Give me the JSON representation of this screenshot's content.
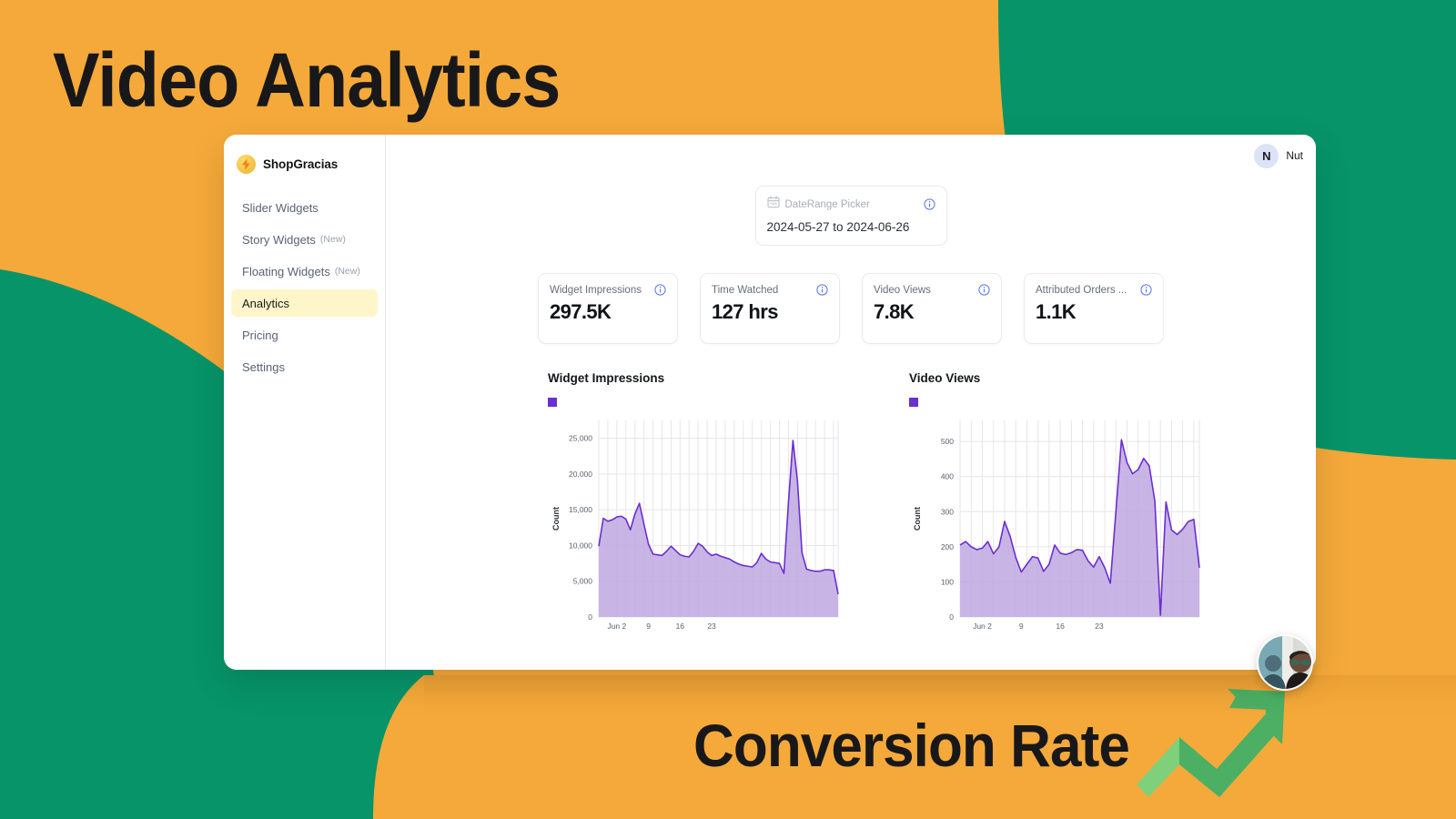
{
  "promo": {
    "headline": "Video Analytics",
    "footline": "Conversion Rate",
    "bg_orange": "#F5A93A",
    "bg_green": "#079468",
    "arrow_light": "#7FD07A",
    "arrow_dark": "#4CAF63"
  },
  "sidebar": {
    "brand": "ShopGracias",
    "brand_icon": "lightning-bolt-icon",
    "items": [
      {
        "label": "Slider Widgets",
        "badge": "",
        "active": false
      },
      {
        "label": "Story Widgets",
        "badge": "(New)",
        "active": false
      },
      {
        "label": "Floating Widgets",
        "badge": "(New)",
        "active": false
      },
      {
        "label": "Analytics",
        "badge": "",
        "active": true
      },
      {
        "label": "Pricing",
        "badge": "",
        "active": false
      },
      {
        "label": "Settings",
        "badge": "",
        "active": false
      }
    ],
    "active_bg": "#FEF6C9"
  },
  "topbar": {
    "avatar_initial": "N",
    "user_name": "Nut"
  },
  "daterange": {
    "label": "DateRange Picker",
    "value": "2024-05-27 to 2024-06-26",
    "calendar_icon": "calendar-icon",
    "info_icon": "info-icon"
  },
  "kpis": [
    {
      "label": "Widget Impressions",
      "value": "297.5K"
    },
    {
      "label": "Time Watched",
      "value": "127 hrs"
    },
    {
      "label": "Video Views",
      "value": "7.8K"
    },
    {
      "label": "Attributed Orders ...",
      "value": "1.1K"
    }
  ],
  "chart_data": [
    {
      "type": "area",
      "title": "Widget Impressions",
      "xlabel": "",
      "ylabel": "Count",
      "ylim": [
        0,
        27500
      ],
      "yticks": [
        0,
        5000,
        10000,
        15000,
        20000,
        25000
      ],
      "ytick_labels": [
        "0",
        "5,000",
        "10,000",
        "15,000",
        "20,000",
        "25,000"
      ],
      "xticks": [
        4,
        11,
        18,
        25
      ],
      "xtick_labels": [
        "Jun 2",
        "9",
        "16",
        "23"
      ],
      "grid": true,
      "legend_position": "top-left",
      "series": [
        {
          "name": "Widget Impressions",
          "color_line": "#6A2FD0",
          "color_fill": "#BFA8E0",
          "values": [
            9900,
            13800,
            13400,
            13600,
            14000,
            14100,
            13700,
            12200,
            14400,
            15900,
            13000,
            10200,
            8800,
            8700,
            8600,
            9200,
            9900,
            9300,
            8700,
            8500,
            8400,
            9200,
            10300,
            9900,
            9100,
            8600,
            8800,
            8500,
            8300,
            8100,
            7700,
            7400,
            7200,
            7100,
            7000,
            7600,
            8900,
            8100,
            7700,
            7600,
            7500,
            6100,
            16000,
            24700,
            19000,
            9000,
            6700,
            6500,
            6400,
            6400,
            6600,
            6600,
            6500,
            3200
          ]
        }
      ]
    },
    {
      "type": "area",
      "title": "Video Views",
      "xlabel": "",
      "ylabel": "Count",
      "ylim": [
        0,
        560
      ],
      "yticks": [
        0,
        100,
        200,
        300,
        400,
        500
      ],
      "ytick_labels": [
        "0",
        "100",
        "200",
        "300",
        "400",
        "500"
      ],
      "xticks": [
        4,
        11,
        18,
        25
      ],
      "xtick_labels": [
        "Jun 2",
        "9",
        "16",
        "23"
      ],
      "grid": true,
      "legend_position": "top-left",
      "series": [
        {
          "name": "Video Views",
          "color_line": "#6A2FD0",
          "color_fill": "#BFA8E0",
          "values": [
            205,
            215,
            200,
            192,
            196,
            215,
            180,
            200,
            272,
            230,
            170,
            128,
            150,
            172,
            168,
            130,
            150,
            205,
            182,
            178,
            183,
            192,
            190,
            160,
            142,
            172,
            140,
            96,
            300,
            505,
            440,
            408,
            420,
            452,
            430,
            330,
            5,
            328,
            248,
            235,
            250,
            272,
            278,
            140
          ]
        }
      ]
    }
  ]
}
